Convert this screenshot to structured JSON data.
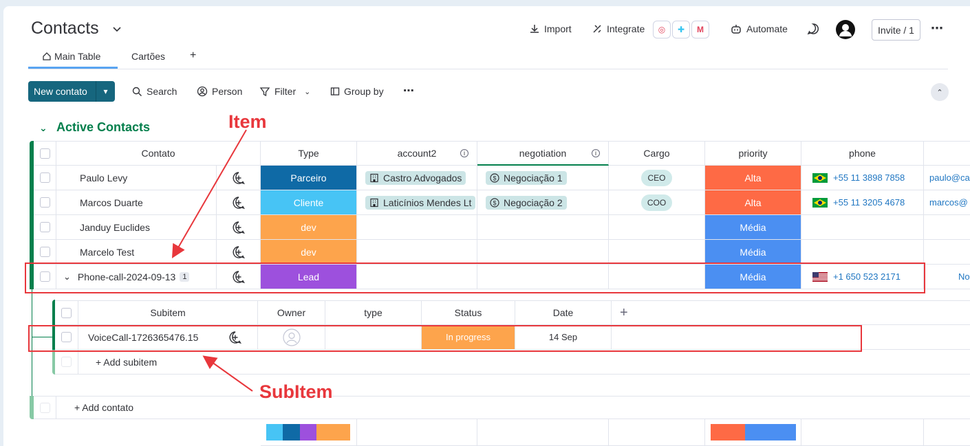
{
  "header": {
    "title": "Contacts",
    "actions": {
      "import": "Import",
      "integrate": "Integrate",
      "automate": "Automate",
      "invite": "Invite / 1"
    }
  },
  "tabs": [
    {
      "label": "Main Table"
    },
    {
      "label": "Cartões"
    },
    {
      "label": "+"
    }
  ],
  "toolbar": {
    "new_button": "New contato",
    "search": "Search",
    "person": "Person",
    "filter": "Filter",
    "group_by": "Group by"
  },
  "group": {
    "title": "Active Contacts",
    "columns": [
      "Contato",
      "Type",
      "account2",
      "negotiation",
      "Cargo",
      "priority",
      "phone"
    ],
    "rows": [
      {
        "name": "Paulo Levy",
        "type": "Parceiro",
        "type_color": "#0f6aa6",
        "account": "Castro Advogados",
        "negotiation": "Negociação 1",
        "cargo": "CEO",
        "priority": "Alta",
        "priority_color": "#fe6a45",
        "phone": "+55 11 3898 7858",
        "email": "paulo@ca"
      },
      {
        "name": "Marcos Duarte",
        "type": "Cliente",
        "type_color": "#47c4f5",
        "account": "Laticínios Mendes Lt",
        "negotiation": "Negociação 2",
        "cargo": "COO",
        "priority": "Alta",
        "priority_color": "#fe6a45",
        "phone": "+55 11 3205 4678",
        "email": "marcos@"
      },
      {
        "name": "Janduy Euclides",
        "type": "dev",
        "type_color": "#fda44c",
        "account": "",
        "negotiation": "",
        "cargo": "",
        "priority": "Média",
        "priority_color": "#4b8ff2",
        "phone": "",
        "email": ""
      },
      {
        "name": "Marcelo Test",
        "type": "dev",
        "type_color": "#fda44c",
        "account": "",
        "negotiation": "",
        "cargo": "",
        "priority": "Média",
        "priority_color": "#4b8ff2",
        "phone": "",
        "email": ""
      },
      {
        "name": "Phone-call-2024-09-13",
        "badge": "1",
        "type": "Lead",
        "type_color": "#9d50dd",
        "account": "",
        "negotiation": "",
        "cargo": "",
        "priority": "Média",
        "priority_color": "#4b8ff2",
        "phone": "+1 650 523 2171",
        "email": "No"
      }
    ],
    "add_item": "+ Add contato"
  },
  "subitems": {
    "columns": [
      "Subitem",
      "Owner",
      "type",
      "Status",
      "Date",
      "+"
    ],
    "rows": [
      {
        "name": "VoiceCall-1726365476.15",
        "status": "In progress",
        "status_color": "#fda44c",
        "date": "14 Sep"
      }
    ],
    "add_subitem": "+ Add subitem"
  },
  "annotations": {
    "item_label": "Item",
    "subitem_label": "SubItem"
  },
  "summary": {
    "type_colors": [
      "#47c4f5",
      "#0f6aa6",
      "#9d50dd",
      "#fda44c"
    ],
    "priority_colors": [
      "#fe6a45",
      "#4b8ff2"
    ]
  }
}
